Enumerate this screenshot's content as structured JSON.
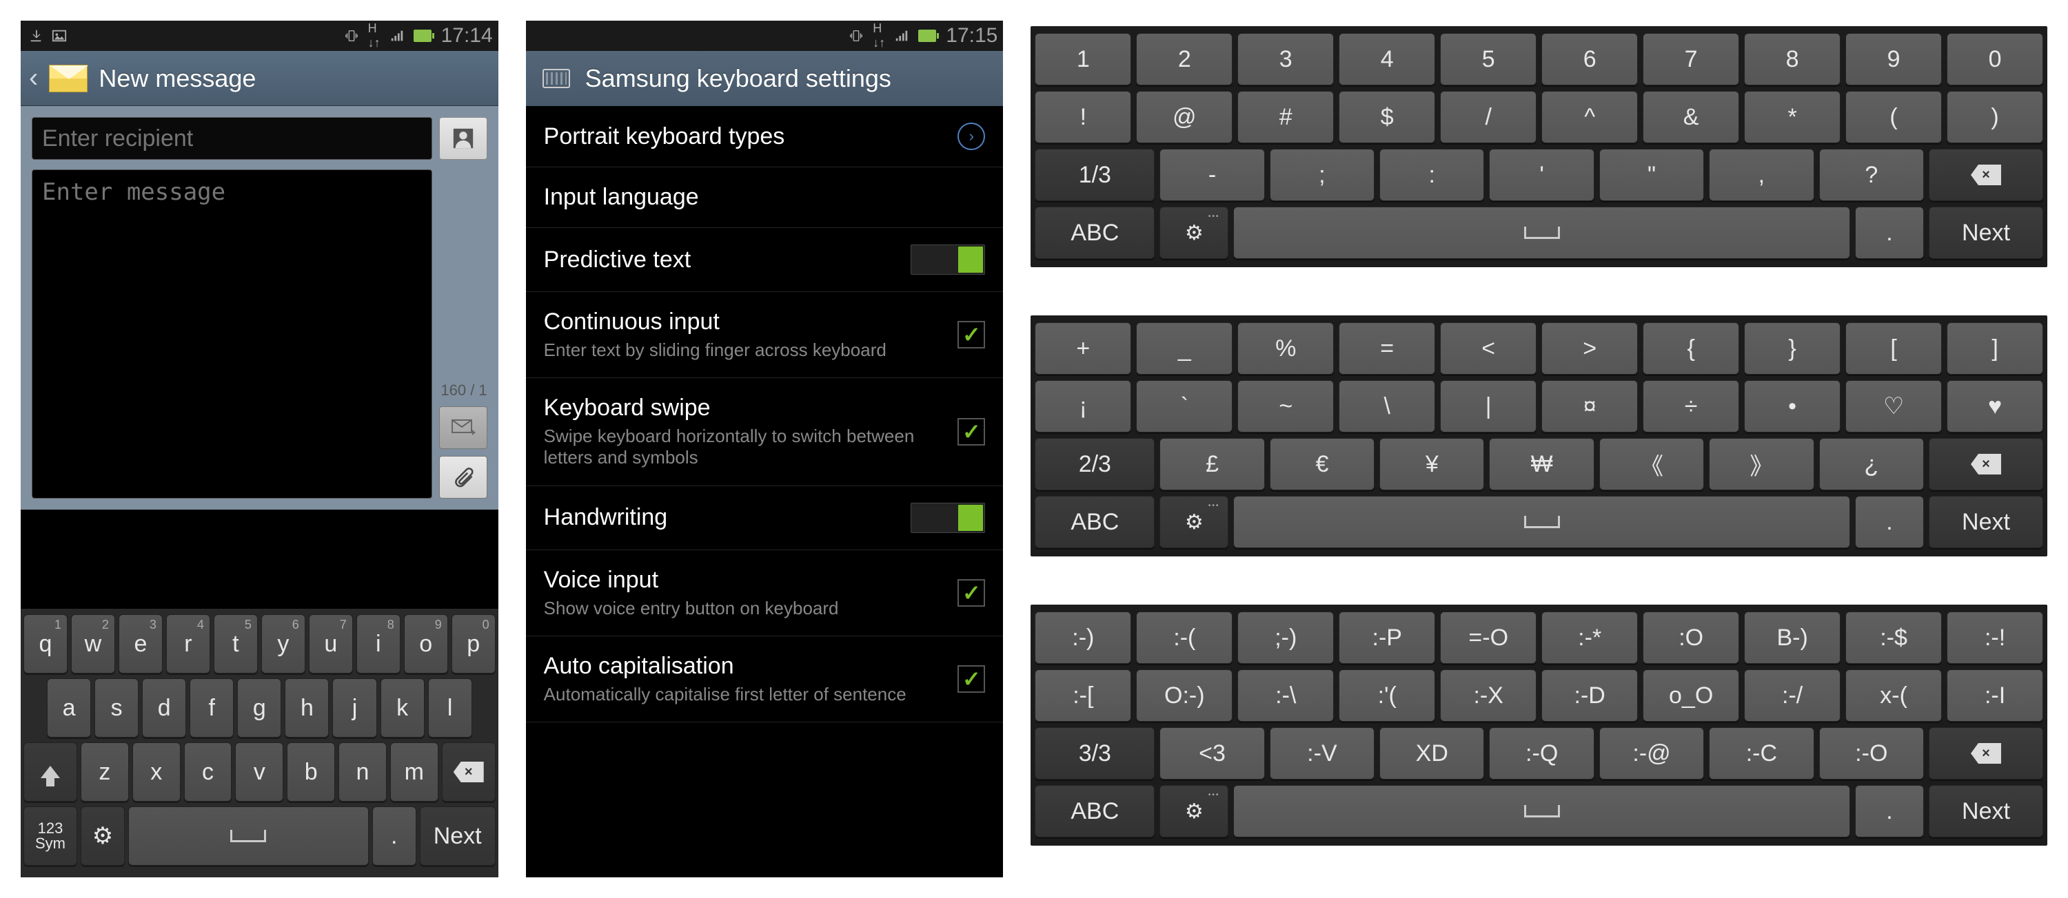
{
  "screen1": {
    "status": {
      "time": "17:14"
    },
    "title": "New message",
    "recipient_placeholder": "Enter recipient",
    "message_placeholder": "Enter message",
    "counter": "160 / 1",
    "keyboard": {
      "row1": [
        {
          "main": "q",
          "alt": "1"
        },
        {
          "main": "w",
          "alt": "2"
        },
        {
          "main": "e",
          "alt": "3"
        },
        {
          "main": "r",
          "alt": "4"
        },
        {
          "main": "t",
          "alt": "5"
        },
        {
          "main": "y",
          "alt": "6"
        },
        {
          "main": "u",
          "alt": "7"
        },
        {
          "main": "i",
          "alt": "8"
        },
        {
          "main": "o",
          "alt": "9"
        },
        {
          "main": "p",
          "alt": "0"
        }
      ],
      "row2": [
        "a",
        "s",
        "d",
        "f",
        "g",
        "h",
        "j",
        "k",
        "l"
      ],
      "row3": [
        "z",
        "x",
        "c",
        "v",
        "b",
        "n",
        "m"
      ],
      "sym_top": "123",
      "sym_bottom": "Sym",
      "period": ".",
      "next": "Next"
    }
  },
  "screen2": {
    "status": {
      "time": "17:15"
    },
    "title": "Samsung keyboard settings",
    "items": [
      {
        "title": "Portrait keyboard types",
        "type": "arrow"
      },
      {
        "title": "Input language",
        "type": "none"
      },
      {
        "title": "Predictive text",
        "type": "toggle",
        "on": true
      },
      {
        "title": "Continuous input",
        "sub": "Enter text by sliding finger across keyboard",
        "type": "check",
        "on": true
      },
      {
        "title": "Keyboard swipe",
        "sub": "Swipe keyboard horizontally to switch between letters and symbols",
        "type": "check",
        "on": true
      },
      {
        "title": "Handwriting",
        "type": "toggle",
        "on": true
      },
      {
        "title": "Voice input",
        "sub": "Show voice entry button on keyboard",
        "type": "check",
        "on": true
      },
      {
        "title": "Auto capitalisation",
        "sub": "Automatically capitalise first letter of sentence",
        "type": "check",
        "on": true
      }
    ]
  },
  "ext_keyboards": [
    {
      "rows": [
        [
          "1",
          "2",
          "3",
          "4",
          "5",
          "6",
          "7",
          "8",
          "9",
          "0"
        ],
        [
          "!",
          "@",
          "#",
          "$",
          "/",
          "^",
          "&",
          "*",
          "(",
          ")"
        ],
        {
          "page": "1/3",
          "keys": [
            "-",
            ";",
            ":",
            "'",
            "\"",
            ",",
            "?"
          ],
          "bksp": true
        },
        {
          "abc": "ABC",
          "gear": true,
          "space": true,
          "period": ".",
          "next": "Next"
        }
      ]
    },
    {
      "rows": [
        [
          "+",
          "_",
          "%",
          "=",
          "<",
          ">",
          "{",
          "}",
          "[",
          "]"
        ],
        [
          "¡",
          "`",
          "~",
          "\\",
          "|",
          "¤",
          "÷",
          "•",
          "♡",
          "♥"
        ],
        {
          "page": "2/3",
          "keys": [
            "£",
            "€",
            "¥",
            "₩",
            "《",
            "》",
            "¿"
          ],
          "bksp": true
        },
        {
          "abc": "ABC",
          "gear": true,
          "space": true,
          "period": ".",
          "next": "Next"
        }
      ]
    },
    {
      "rows": [
        [
          ":-)",
          ":-(",
          ";-)",
          ":-P",
          "=-O",
          ":-*",
          ":O",
          "B-)",
          ":-$",
          ":-!"
        ],
        [
          ":-[",
          "O:-)",
          ":-\\",
          ":'(",
          ":-X",
          ":-D",
          "o_O",
          ":-/",
          "x-(",
          ":-I"
        ],
        {
          "page": "3/3",
          "keys": [
            "<3",
            ":-V",
            "XD",
            ":-Q",
            ":-@",
            ":-C",
            ":-O"
          ],
          "bksp": true
        },
        {
          "abc": "ABC",
          "gear": true,
          "space": true,
          "period": ".",
          "next": "Next"
        }
      ]
    }
  ]
}
